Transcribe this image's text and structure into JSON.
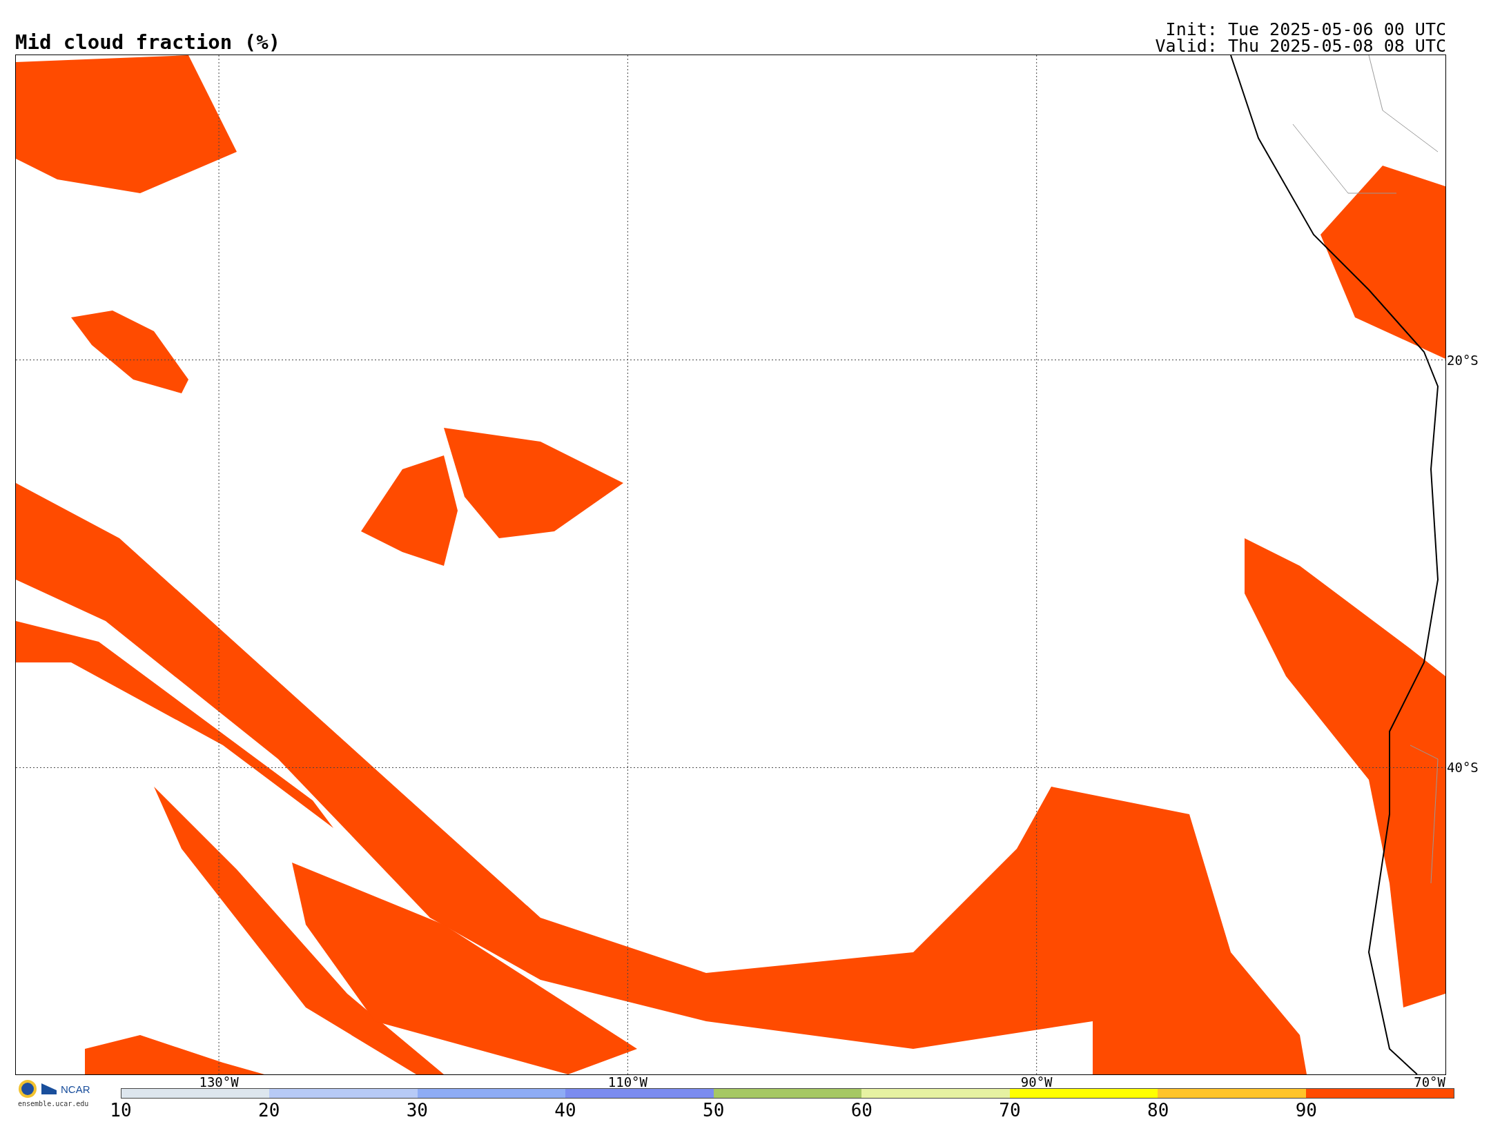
{
  "title": "Mid cloud fraction (%)",
  "init": "Init: Tue 2025-05-06 00 UTC",
  "valid": "Valid: Thu 2025-05-08 08 UTC",
  "map": {
    "lat_labels": [
      "20°S",
      "40°S"
    ],
    "lon_labels": [
      "130°W",
      "110°W",
      "90°W",
      "70°W"
    ]
  },
  "colorbar": {
    "ticks": [
      "10",
      "20",
      "30",
      "40",
      "50",
      "60",
      "70",
      "80",
      "90"
    ],
    "segments": [
      {
        "color": "#dde6ee"
      },
      {
        "color": "#b7caf6"
      },
      {
        "color": "#8eacf5"
      },
      {
        "color": "#7b8cf0"
      },
      {
        "color": "#a6c864"
      },
      {
        "color": "#e6f2a2"
      },
      {
        "color": "#ffff00"
      },
      {
        "color": "#ffc42a"
      },
      {
        "color": "#ff4b00"
      }
    ]
  },
  "logo": {
    "org": "NCAR",
    "site": "ensemble.ucar.edu"
  }
}
